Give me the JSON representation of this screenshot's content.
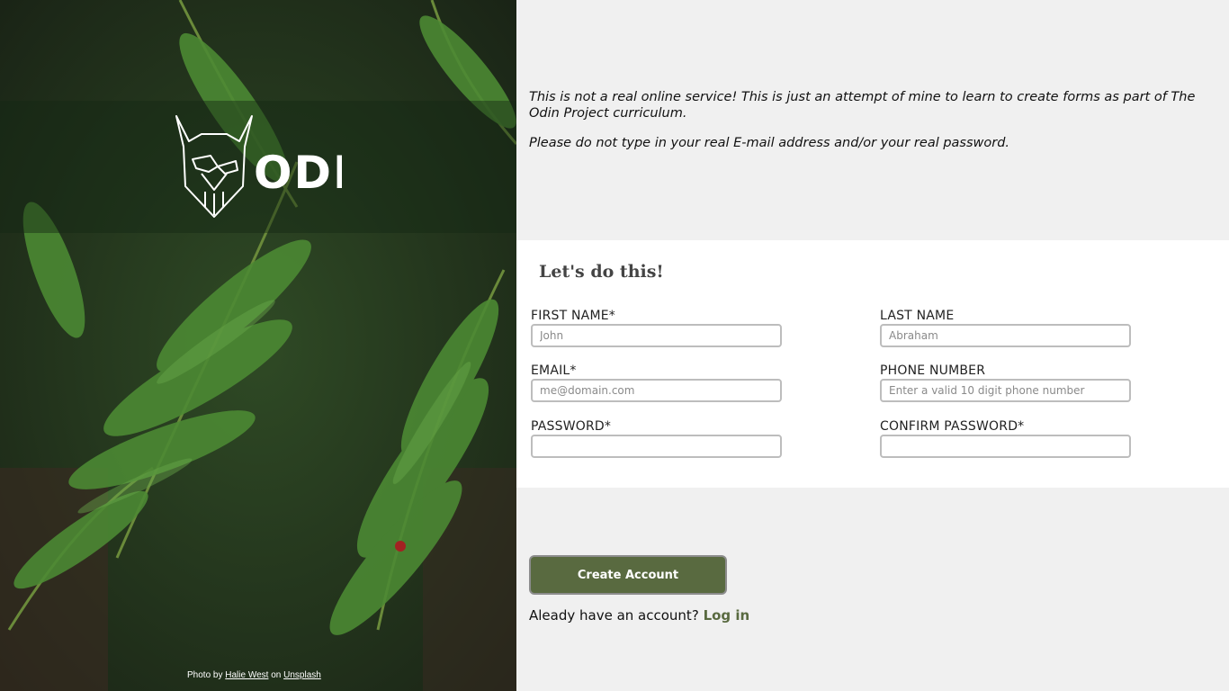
{
  "brand": {
    "logo_text": "ODIN"
  },
  "photo_credit": {
    "prefix": "Photo by",
    "author": "Halie West",
    "middle": "on",
    "site": "Unsplash"
  },
  "disclaimer": {
    "line1": "This is not a real online service! This is just an attempt of mine to learn to create forms as part of The Odin Project curriculum.",
    "line2": "Please do not type in your real E-mail address and/or your real password."
  },
  "form": {
    "title": "Let's do this!",
    "first_name": {
      "label": "FIRST NAME*",
      "placeholder": "John",
      "value": ""
    },
    "last_name": {
      "label": "LAST NAME",
      "placeholder": "Abraham",
      "value": ""
    },
    "email": {
      "label": "EMAIL*",
      "placeholder": "me@domain.com",
      "value": ""
    },
    "phone": {
      "label": "PHONE NUMBER",
      "placeholder": "Enter a valid 10 digit phone number",
      "value": ""
    },
    "password": {
      "label": "PASSWORD*",
      "placeholder": "",
      "value": ""
    },
    "confirm_password": {
      "label": "CONFIRM PASSWORD*",
      "placeholder": "",
      "value": ""
    }
  },
  "actions": {
    "create_label": "Create Account",
    "login_prompt": "Aleady have an account?",
    "login_link": "Log in"
  },
  "colors": {
    "accent": "#596a40",
    "panel": "#f0f0f0",
    "card": "#ffffff"
  }
}
